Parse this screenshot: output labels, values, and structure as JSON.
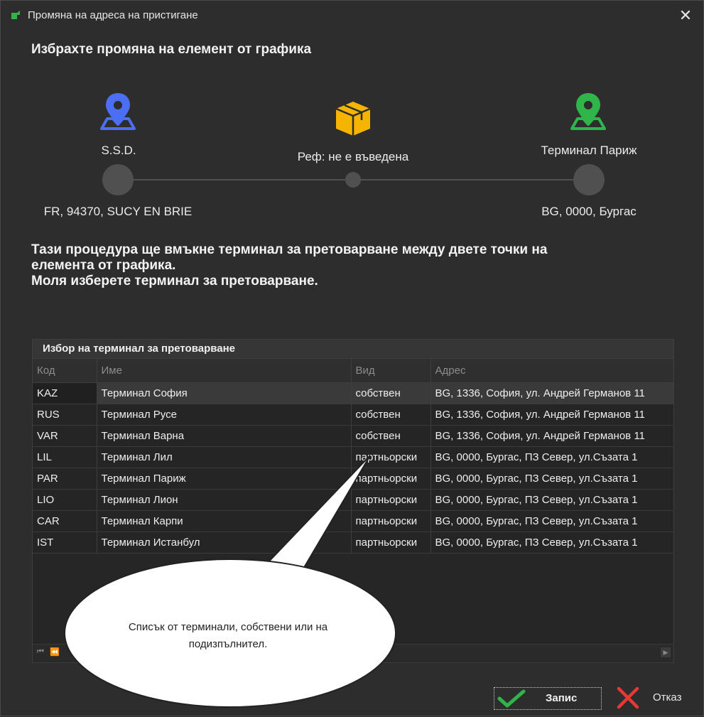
{
  "window": {
    "title": "Промяна на адреса на пристигане"
  },
  "heading": "Избрахте промяна на елемент от графика",
  "route": {
    "from": {
      "name": "S.S.D.",
      "address": "FR, 94370, SUCY EN BRIE",
      "icon": "location-pin-blue-icon",
      "color": "#4c6ef5"
    },
    "middle": {
      "label": "Реф: не е въведена",
      "icon": "package-icon",
      "color": "#f5b400"
    },
    "to": {
      "name": "Терминал Париж",
      "address": "BG, 0000, Бургас",
      "icon": "location-pin-green-icon",
      "color": "#2fb54a"
    }
  },
  "info": {
    "line1": "Тази процедура ще вмъкне терминал за претоварване между двете точки на",
    "line2": "елемента от графика.",
    "line3": "Моля изберете терминал за претоварване."
  },
  "table": {
    "title": "Избор на терминал за претоварване",
    "columns": [
      "Код",
      "Име",
      "Вид",
      "Адрес"
    ],
    "rows": [
      [
        "KAZ",
        "Терминал София",
        "собствен",
        "BG, 1336, София, ул. Андрей Германов 11"
      ],
      [
        "RUS",
        "Терминал Русе",
        "собствен",
        "BG, 1336, София, ул. Андрей Германов 11"
      ],
      [
        "VAR",
        "Терминал Варна",
        "собствен",
        "BG, 1336, София, ул. Андрей Германов 11"
      ],
      [
        "LIL",
        "Терминал Лил",
        "партньорски",
        "BG, 0000, Бургас, ПЗ Север, ул.Съзата 1"
      ],
      [
        "PAR",
        "Терминал Париж",
        "партньорски",
        "BG, 0000, Бургас, ПЗ Север, ул.Съзата 1"
      ],
      [
        "LIO",
        "Терминал Лион",
        "партньорски",
        "BG, 0000, Бургас, ПЗ Север, ул.Съзата 1"
      ],
      [
        "CAR",
        "Терминал Карпи",
        "партньорски",
        "BG, 0000, Бургас, ПЗ Север, ул.Съзата 1"
      ],
      [
        "IST",
        "Терминал Истанбул",
        "партньорски",
        "BG, 0000, Бургас, ПЗ Север, ул.Съзата 1"
      ]
    ]
  },
  "callout": {
    "line1": "Списък от терминали, собствени или на",
    "line2": "подизпълнител."
  },
  "buttons": {
    "save": "Запис",
    "cancel": "Отказ"
  },
  "colors": {
    "accent_green": "#2fb54a",
    "cancel_red": "#e53935"
  }
}
